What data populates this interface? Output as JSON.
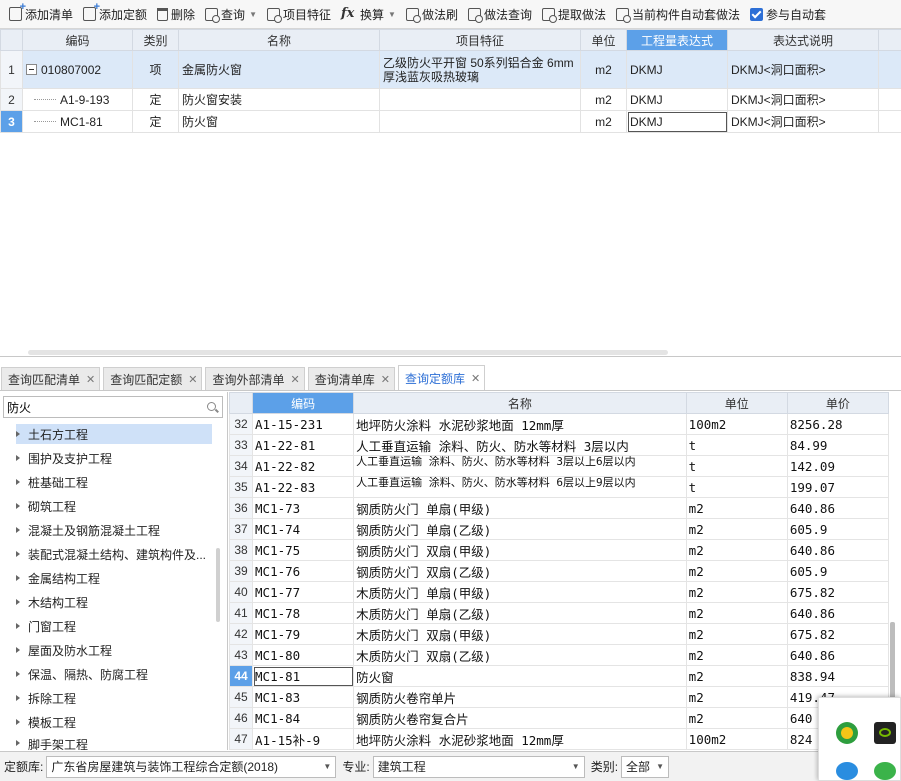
{
  "toolbar": {
    "items": [
      {
        "label": "添加清单",
        "icon": "add-list-icon"
      },
      {
        "label": "添加定额",
        "icon": "add-quota-icon"
      },
      {
        "label": "删除",
        "icon": "trash-icon"
      },
      {
        "label": "查询",
        "icon": "query-icon",
        "dropdown": true
      },
      {
        "label": "项目特征",
        "icon": "feature-icon"
      },
      {
        "label": "换算",
        "icon": "fx-icon",
        "dropdown": true
      },
      {
        "label": "做法刷",
        "icon": "brush-icon"
      },
      {
        "label": "做法查询",
        "icon": "method-query-icon"
      },
      {
        "label": "提取做法",
        "icon": "extract-icon"
      },
      {
        "label": "当前构件自动套做法",
        "icon": "auto-apply-icon"
      },
      {
        "label": "参与自动套",
        "icon": "checkbox-checked-icon",
        "checked": true
      }
    ]
  },
  "top_grid": {
    "headers": [
      "编码",
      "类别",
      "名称",
      "项目特征",
      "单位",
      "工程量表达式",
      "表达式说明"
    ],
    "rows": [
      {
        "num": "1",
        "code": "010807002",
        "type": "项",
        "name": "金属防火窗",
        "feature": "乙级防火平开窗 50系列铝合金 6mm厚浅蓝灰吸热玻璃",
        "unit": "m2",
        "expr": "DKMJ",
        "desc": "DKMJ<洞口面积>"
      },
      {
        "num": "2",
        "code": "A1-9-193",
        "type": "定",
        "name": "防火窗安装",
        "feature": "",
        "unit": "m2",
        "expr": "DKMJ",
        "desc": "DKMJ<洞口面积>"
      },
      {
        "num": "3",
        "code": "MC1-81",
        "type": "定",
        "name": "防火窗",
        "feature": "",
        "unit": "m2",
        "expr": "DKMJ",
        "desc": "DKMJ<洞口面积>"
      }
    ]
  },
  "tabs": [
    {
      "label": "查询匹配清单"
    },
    {
      "label": "查询匹配定额"
    },
    {
      "label": "查询外部清单"
    },
    {
      "label": "查询清单库"
    },
    {
      "label": "查询定额库",
      "active": true
    }
  ],
  "search": {
    "value": "防火"
  },
  "categories": [
    "土石方工程",
    "围护及支护工程",
    "桩基础工程",
    "砌筑工程",
    "混凝土及钢筋混凝土工程",
    "装配式混凝土结构、建筑构件及...",
    "金属结构工程",
    "木结构工程",
    "门窗工程",
    "屋面及防水工程",
    "保温、隔热、防腐工程",
    "拆除工程",
    "模板工程",
    "脚手架工程"
  ],
  "quota_grid": {
    "headers": [
      "编码",
      "名称",
      "单位",
      "单价"
    ],
    "rows": [
      {
        "num": "32",
        "code": "A1-15-231",
        "name": "地坪防火涂料 水泥砂浆地面 12mm厚",
        "unit": "100m2",
        "price": "8256.28"
      },
      {
        "num": "33",
        "code": "A1-22-81",
        "name": "人工垂直运输 涂料、防火、防水等材料 3层以内",
        "unit": "t",
        "price": "84.99"
      },
      {
        "num": "34",
        "code": "A1-22-82",
        "name": "人工垂直运输 涂料、防火、防水等材料 3层以上6层以内",
        "unit": "t",
        "price": "142.09"
      },
      {
        "num": "35",
        "code": "A1-22-83",
        "name": "人工垂直运输 涂料、防火、防水等材料 6层以上9层以内",
        "unit": "t",
        "price": "199.07"
      },
      {
        "num": "36",
        "code": "MC1-73",
        "name": "钢质防火门 单扇(甲级)",
        "unit": "m2",
        "price": "640.86"
      },
      {
        "num": "37",
        "code": "MC1-74",
        "name": "钢质防火门 单扇(乙级)",
        "unit": "m2",
        "price": "605.9"
      },
      {
        "num": "38",
        "code": "MC1-75",
        "name": "钢质防火门 双扇(甲级)",
        "unit": "m2",
        "price": "640.86"
      },
      {
        "num": "39",
        "code": "MC1-76",
        "name": "钢质防火门 双扇(乙级)",
        "unit": "m2",
        "price": "605.9"
      },
      {
        "num": "40",
        "code": "MC1-77",
        "name": "木质防火门 单扇(甲级)",
        "unit": "m2",
        "price": "675.82"
      },
      {
        "num": "41",
        "code": "MC1-78",
        "name": "木质防火门 单扇(乙级)",
        "unit": "m2",
        "price": "640.86"
      },
      {
        "num": "42",
        "code": "MC1-79",
        "name": "木质防火门 双扇(甲级)",
        "unit": "m2",
        "price": "675.82"
      },
      {
        "num": "43",
        "code": "MC1-80",
        "name": "木质防火门 双扇(乙级)",
        "unit": "m2",
        "price": "640.86"
      },
      {
        "num": "44",
        "code": "MC1-81",
        "name": "防火窗",
        "unit": "m2",
        "price": "838.94"
      },
      {
        "num": "45",
        "code": "MC1-83",
        "name": "钢质防火卷帘单片",
        "unit": "m2",
        "price": "419.47"
      },
      {
        "num": "46",
        "code": "MC1-84",
        "name": "钢质防火卷帘复合片",
        "unit": "m2",
        "price": "640"
      },
      {
        "num": "47",
        "code": "A1-15补-9",
        "name": "地坪防火涂料 水泥砂浆地面 12mm厚",
        "unit": "100m2",
        "price": "824"
      }
    ]
  },
  "footer": {
    "library_label": "定额库:",
    "library_value": "广东省房屋建筑与装饰工程综合定额(2018)",
    "major_label": "专业:",
    "major_value": "建筑工程",
    "category_label": "类别:",
    "category_value": "全部"
  },
  "colors": {
    "accent": "#5ca0e8",
    "selected_row": "#dce9f8",
    "header_bg": "#e9eef5"
  }
}
